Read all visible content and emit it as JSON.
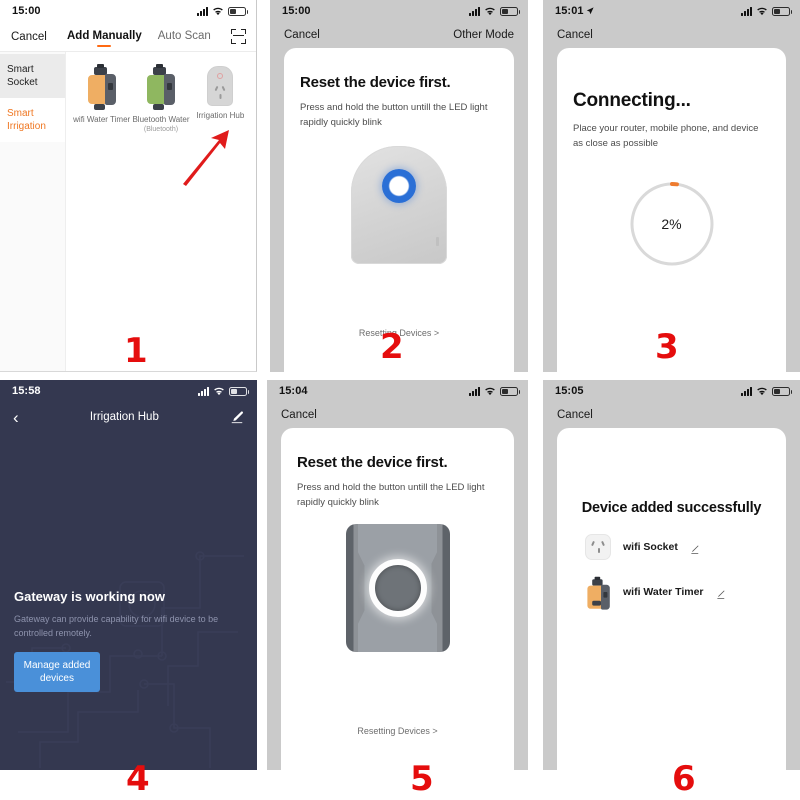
{
  "panels": [
    {
      "number": "1",
      "status": {
        "time": "15:00",
        "has_location": false
      },
      "nav": {
        "cancel": "Cancel",
        "tab_manual": "Add Manually",
        "tab_auto": "Auto Scan",
        "scan_icon": "scan-icon"
      },
      "sidebar": [
        {
          "label": "Smart Socket",
          "selected": false
        },
        {
          "label": "Smart Irrigation",
          "selected": true
        }
      ],
      "devices": [
        {
          "name": "wifi Water Timer",
          "sub": "",
          "icon": "water-timer-orange-icon"
        },
        {
          "name": "Bluetooth Water",
          "sub": "(Bluetooth)",
          "icon": "water-timer-green-icon"
        },
        {
          "name": "Irrigation Hub",
          "sub": "",
          "icon": "irrigation-hub-icon"
        }
      ],
      "annotation": {
        "arrow_color": "#e01b1b",
        "points_to": "Irrigation Hub"
      }
    },
    {
      "number": "2",
      "status": {
        "time": "15:00",
        "has_location": false
      },
      "nav": {
        "left": "Cancel",
        "right": "Other Mode"
      },
      "title": "Reset the device first.",
      "body": "Press and hold the button untill the LED light rapidly quickly blink",
      "device_art": "gray-hub-blue-ring",
      "footer_link": "Resetting Devices >"
    },
    {
      "number": "3",
      "status": {
        "time": "15:01",
        "has_location": true
      },
      "nav": {
        "left": "Cancel",
        "right": ""
      },
      "title": "Connecting...",
      "body": "Place your router, mobile phone, and device as close as possible",
      "progress": {
        "percent": 2,
        "label": "2%",
        "ring_color": "#ee7b2f",
        "track_color": "#d8d8d8"
      }
    },
    {
      "number": "4",
      "status": {
        "time": "15:58",
        "has_location": false
      },
      "nav": {
        "back_icon": "chevron-left-icon",
        "title": "Irrigation Hub",
        "edit_icon": "pencil-icon"
      },
      "heading": "Gateway is working now",
      "sub": "Gateway can provide capability for wifi device to be controlled remotely.",
      "button": "Manage added devices",
      "theme": {
        "bg": "#343850",
        "accent": "#4a90d9"
      }
    },
    {
      "number": "5",
      "status": {
        "time": "15:04",
        "has_location": false
      },
      "nav": {
        "left": "Cancel",
        "right": ""
      },
      "title": "Reset the device first.",
      "body": "Press and hold the button untill the LED light rapidly quickly blink",
      "device_art": "dark-gray-device-white-ring",
      "footer_link": "Resetting Devices >"
    },
    {
      "number": "6",
      "status": {
        "time": "15:05",
        "has_location": false
      },
      "nav": {
        "left": "Cancel",
        "right": ""
      },
      "title": "Device added successfully",
      "devices": [
        {
          "name": "wifi Socket",
          "icon": "socket-icon",
          "edit_icon": "pencil-icon"
        },
        {
          "name": "wifi Water Timer",
          "icon": "water-timer-orange-icon",
          "edit_icon": "pencil-icon"
        }
      ]
    }
  ]
}
